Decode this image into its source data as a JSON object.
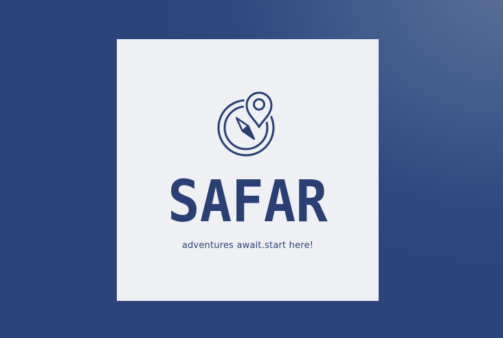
{
  "brand": {
    "name": "SAFAR",
    "tagline": "adventures await.start here!"
  },
  "icons": {
    "emblem": "compass-with-location-pin-icon"
  },
  "colors": {
    "background": "#30497f",
    "card": "#eef0f4",
    "brand": "#2a3f74"
  }
}
